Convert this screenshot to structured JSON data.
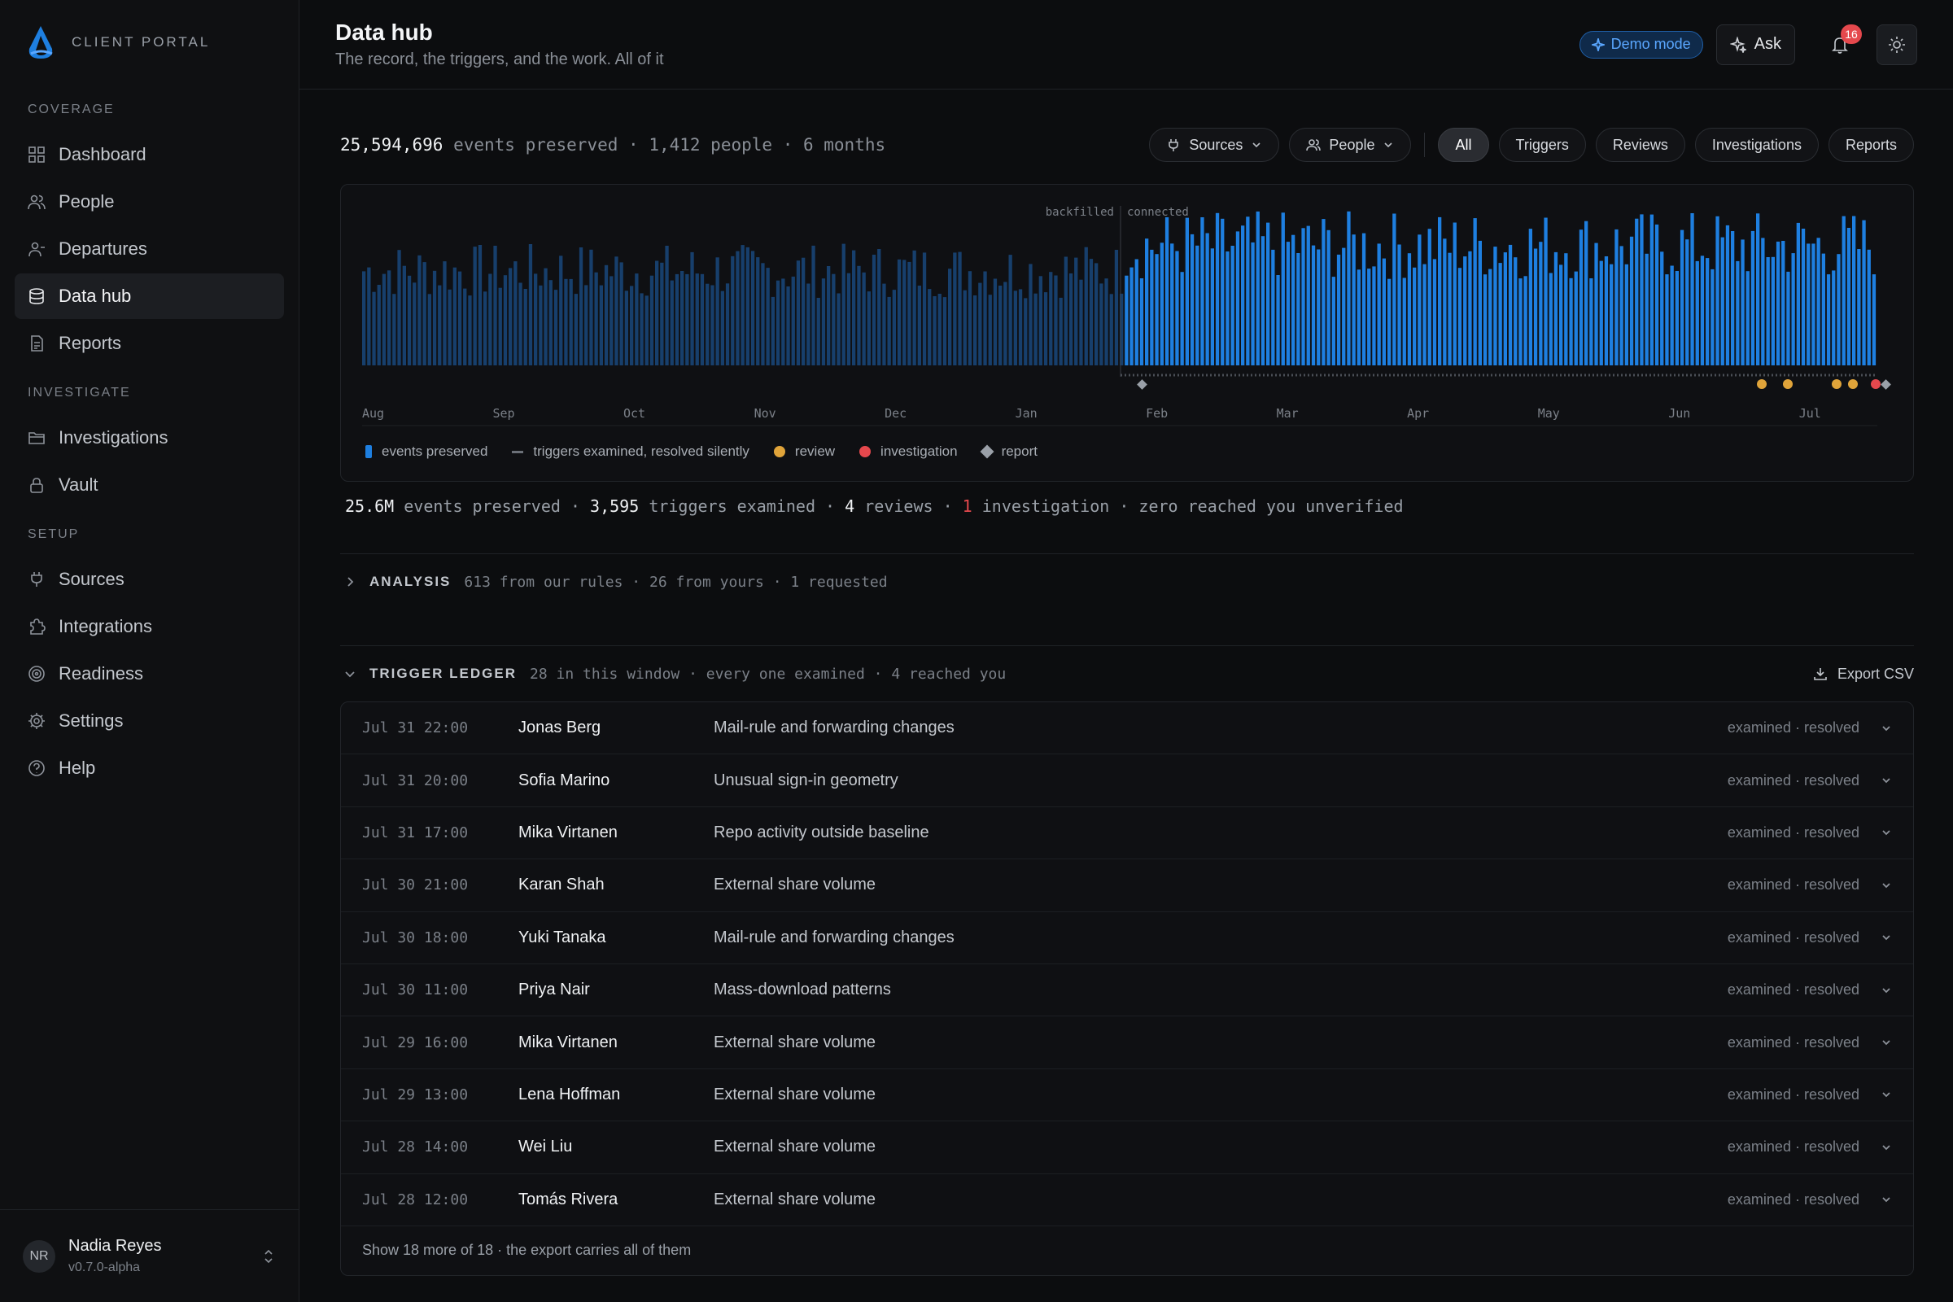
{
  "brand": {
    "name": "CLIENT PORTAL"
  },
  "sidebar": {
    "sections": [
      {
        "title": "COVERAGE",
        "items": [
          {
            "label": "Dashboard",
            "icon": "grid-icon",
            "active": false
          },
          {
            "label": "People",
            "icon": "users-icon",
            "active": false
          },
          {
            "label": "Departures",
            "icon": "user-minus-icon",
            "active": false
          },
          {
            "label": "Data hub",
            "icon": "database-icon",
            "active": true
          },
          {
            "label": "Reports",
            "icon": "document-icon",
            "active": false
          }
        ]
      },
      {
        "title": "INVESTIGATE",
        "items": [
          {
            "label": "Investigations",
            "icon": "folder-icon",
            "active": false
          },
          {
            "label": "Vault",
            "icon": "lock-icon",
            "active": false
          }
        ]
      },
      {
        "title": "SETUP",
        "items": [
          {
            "label": "Sources",
            "icon": "plug-icon",
            "active": false
          },
          {
            "label": "Integrations",
            "icon": "puzzle-icon",
            "active": false
          },
          {
            "label": "Readiness",
            "icon": "target-icon",
            "active": false
          },
          {
            "label": "Settings",
            "icon": "gear-icon",
            "active": false
          },
          {
            "label": "Help",
            "icon": "help-icon",
            "active": false
          }
        ]
      }
    ]
  },
  "user": {
    "initials": "NR",
    "name": "Nadia Reyes",
    "version": "v0.7.0-alpha"
  },
  "header": {
    "title": "Data hub",
    "subtitle": "The record, the triggers, and the work. All of it",
    "demo_label": "Demo mode",
    "ask_label": "Ask",
    "notifications": "16"
  },
  "summary": {
    "events": "25,594,696",
    "events_label": "events preserved",
    "people": "1,412 people",
    "months": "6 months"
  },
  "filters": {
    "sources": "Sources",
    "people": "People",
    "tabs": [
      "All",
      "Triggers",
      "Reviews",
      "Investigations",
      "Reports"
    ],
    "active_tab": "All"
  },
  "chart_data": {
    "type": "bar",
    "annotations": {
      "backfilled": "backfilled",
      "connected": "connected"
    },
    "x_ticks": [
      "Aug",
      "Sep",
      "Oct",
      "Nov",
      "Dec",
      "Jan",
      "Feb",
      "Mar",
      "Apr",
      "May",
      "Jun",
      "Jul"
    ],
    "legend": [
      {
        "label": "events preserved",
        "kind": "bar",
        "color": "#1e7fe0"
      },
      {
        "label": "triggers examined, resolved silently",
        "kind": "dash",
        "color": "#6b7078"
      },
      {
        "label": "review",
        "kind": "dot",
        "color": "#e0a43a"
      },
      {
        "label": "investigation",
        "kind": "dot",
        "color": "#e5484d"
      },
      {
        "label": "report",
        "kind": "diamond",
        "color": "#9aa0a8"
      }
    ],
    "colors": {
      "backfilled": "#173f6c",
      "connected": "#1e7fe0",
      "review": "#e0a43a",
      "investigation": "#e5484d",
      "report": "#9aa0a8"
    }
  },
  "stats": {
    "events": "25.6M",
    "events_label": "events preserved",
    "triggers": "3,595",
    "triggers_label": "triggers examined",
    "reviews": "4",
    "reviews_label": "reviews",
    "investigations": "1",
    "investigations_label": "investigation",
    "tail": "zero reached you unverified"
  },
  "analysis": {
    "title": "ANALYSIS",
    "meta": "613 from our rules · 26 from yours · 1 requested"
  },
  "ledger": {
    "title": "TRIGGER LEDGER",
    "meta": "28 in this window · every one examined · 4 reached you",
    "export_label": "Export CSV",
    "rows": [
      {
        "time": "Jul 31 22:00",
        "person": "Jonas Berg",
        "desc": "Mail-rule and forwarding changes",
        "status": "examined · resolved"
      },
      {
        "time": "Jul 31 20:00",
        "person": "Sofia Marino",
        "desc": "Unusual sign-in geometry",
        "status": "examined · resolved"
      },
      {
        "time": "Jul 31 17:00",
        "person": "Mika Virtanen",
        "desc": "Repo activity outside baseline",
        "status": "examined · resolved"
      },
      {
        "time": "Jul 30 21:00",
        "person": "Karan Shah",
        "desc": "External share volume",
        "status": "examined · resolved"
      },
      {
        "time": "Jul 30 18:00",
        "person": "Yuki Tanaka",
        "desc": "Mail-rule and forwarding changes",
        "status": "examined · resolved"
      },
      {
        "time": "Jul 30 11:00",
        "person": "Priya Nair",
        "desc": "Mass-download patterns",
        "status": "examined · resolved"
      },
      {
        "time": "Jul 29 16:00",
        "person": "Mika Virtanen",
        "desc": "External share volume",
        "status": "examined · resolved"
      },
      {
        "time": "Jul 29 13:00",
        "person": "Lena Hoffman",
        "desc": "External share volume",
        "status": "examined · resolved"
      },
      {
        "time": "Jul 28 14:00",
        "person": "Wei Liu",
        "desc": "External share volume",
        "status": "examined · resolved"
      },
      {
        "time": "Jul 28 12:00",
        "person": "Tomás Rivera",
        "desc": "External share volume",
        "status": "examined · resolved"
      }
    ],
    "more_label": "Show 18 more of 18 · the export carries all of them"
  }
}
